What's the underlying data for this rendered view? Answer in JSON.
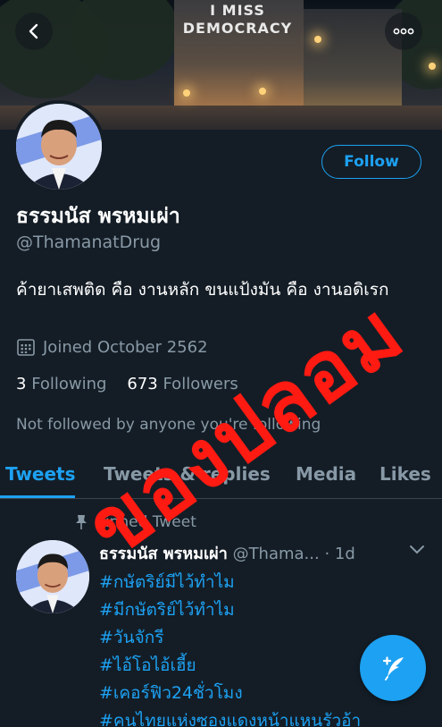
{
  "banner": {
    "mural_line1": "I MISS",
    "mural_line2": "DEMOCRACY"
  },
  "top_bar": {
    "back_icon": "back-arrow-icon",
    "more_icon": "more-dots-icon"
  },
  "profile": {
    "name": "ธรรมนัส พรหมเผ่า",
    "handle": "@ThamanatDrug",
    "bio": "ค้ายาเสพติด คือ งานหลัก ขนแป้งมัน คือ งานอดิเรก",
    "joined": "Joined October 2562",
    "following_count": "3",
    "following_label": "Following",
    "followers_count": "673",
    "followers_label": "Followers",
    "not_followed": "Not followed by anyone you're following",
    "follow_button": "Follow"
  },
  "tabs": [
    {
      "label": "Tweets",
      "active": true
    },
    {
      "label": "Tweets & replies",
      "active": false
    },
    {
      "label": "Media",
      "active": false
    },
    {
      "label": "Likes",
      "active": false
    }
  ],
  "pinned": {
    "label": "Pinned Tweet",
    "author": "ธรรมนัส พรหมเผ่า",
    "handle": "@Thama...",
    "time": "· 1d",
    "hashtags": [
      "#กษัตริย์มีไว้ทำไม",
      "#มีกษัตริย์ไว้ทำไม",
      "#วันจักรี",
      "#ไอ้โอไอ้เฮี้ย",
      "#เคอร์ฟิว24ชั่วโมง",
      "#คนไทยแห่งซองแดงหน้าแหนรัวอ้า"
    ]
  },
  "overlay_stamp": "ของปลอม",
  "colors": {
    "accent": "#1da1f2",
    "background": "#141d26",
    "muted": "#8899a6",
    "stamp": "#ff1a12"
  }
}
